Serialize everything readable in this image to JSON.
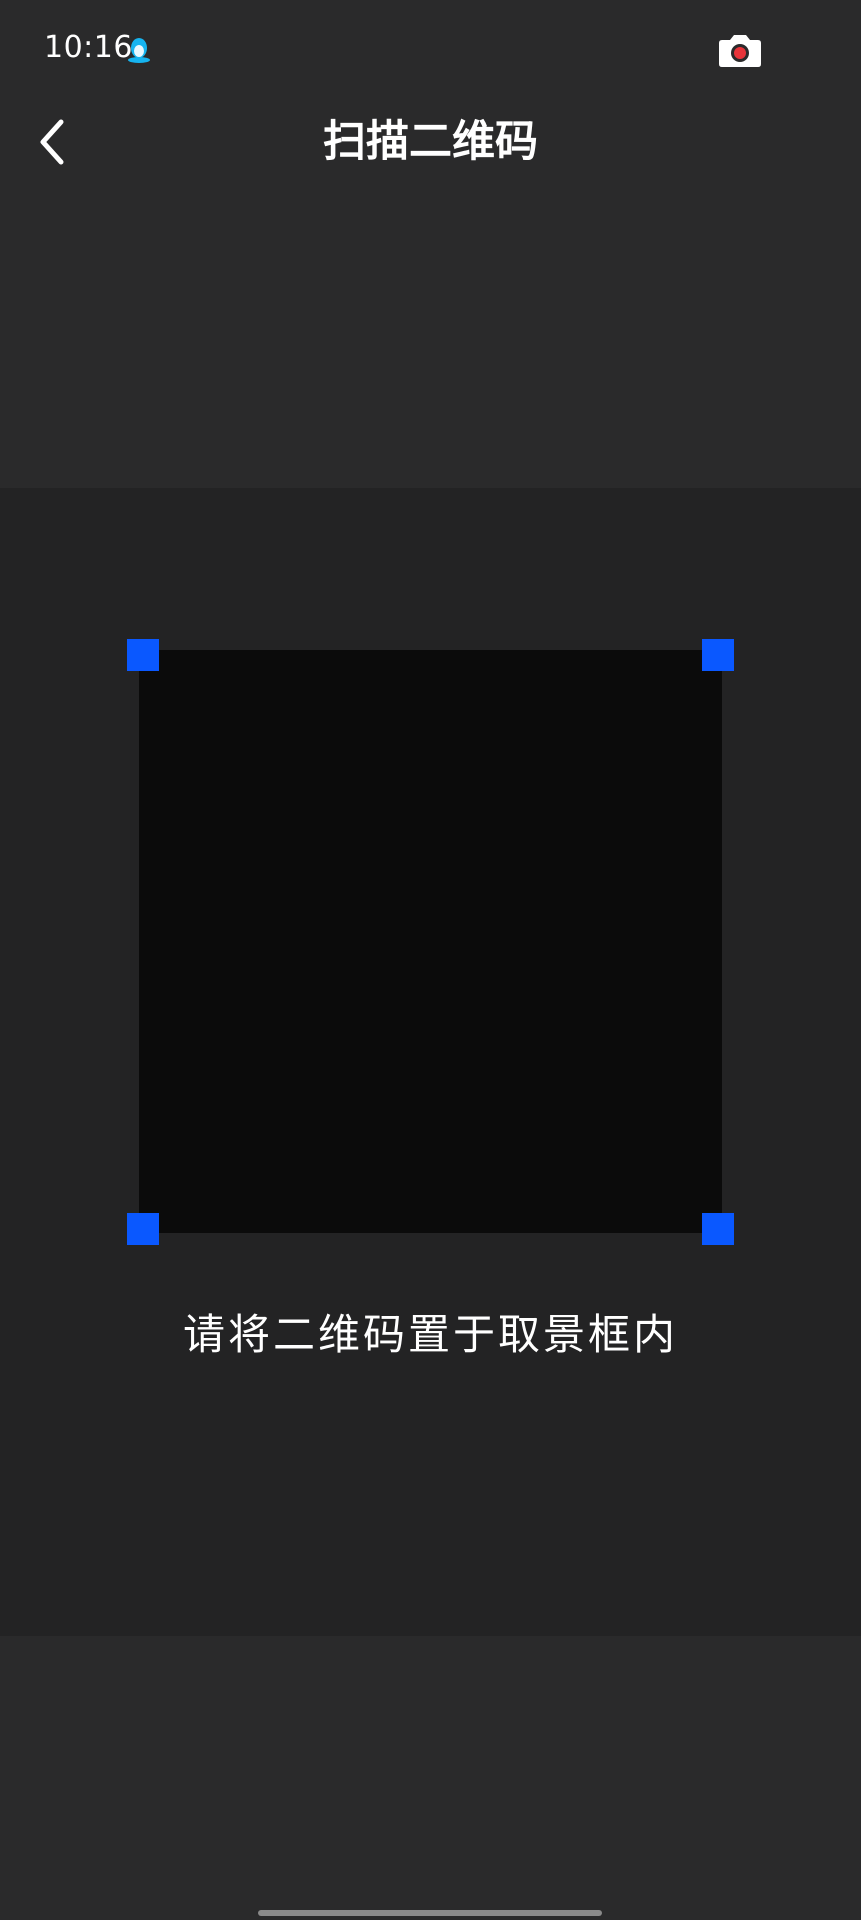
{
  "status_bar": {
    "time": "10:16",
    "notification_icon": "qq-penguin-icon",
    "camera_in_use_icon": "camera-recording-icon"
  },
  "nav": {
    "back_icon": "chevron-left-icon",
    "title": "扫描二维码"
  },
  "scanner": {
    "frame_corner_color": "#0a58ff",
    "hint": "请将二维码置于取景框内"
  },
  "colors": {
    "background": "#2a2a2b",
    "preview": "#232324",
    "scan_area": "#0b0b0b",
    "accent": "#0a58ff"
  }
}
